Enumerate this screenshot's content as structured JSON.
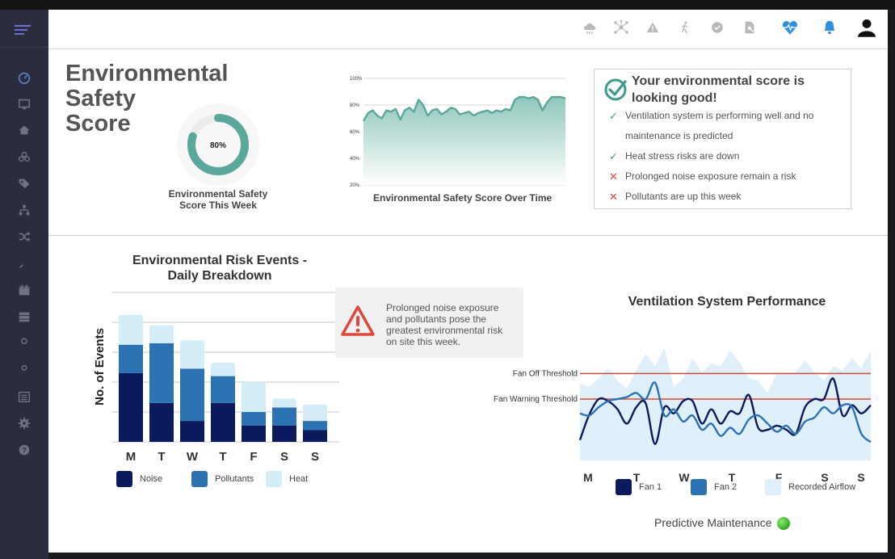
{
  "sidebar": {
    "icons": [
      "dashboard-icon",
      "monitor-icon",
      "home-icon",
      "biohazard-icon",
      "tags-icon",
      "org-chart-icon",
      "shuffle-icon",
      "rocket-icon",
      "calendar-icon",
      "server-icon",
      "user-icon",
      "user-shield-icon",
      "list-icon",
      "gear-icon",
      "help-icon"
    ]
  },
  "header": {
    "icons": [
      "cloud-icon",
      "network-icon",
      "warning-icon",
      "walking-person-icon",
      "check-circle-icon",
      "document-search-icon",
      "heart-monitor-icon",
      "bell-icon",
      "user-account-icon"
    ]
  },
  "score": {
    "title_lines": [
      "Environmental",
      "Safety",
      "Score"
    ],
    "gauge_value": 0.8,
    "gauge_text": "80%",
    "gauge_label": "Environmental Safety Score This Week"
  },
  "score_chart": {
    "caption": "Environmental Safety Score Over Time",
    "y_ticks": [
      "100%",
      "80%",
      "60%",
      "40%",
      "20%"
    ],
    "y_tick_values": [
      100,
      80,
      60,
      40,
      20
    ],
    "values": [
      68,
      74,
      76,
      72,
      70,
      76,
      75,
      77,
      69,
      76,
      78,
      75,
      84,
      80,
      72,
      76,
      77,
      73,
      75,
      78,
      77,
      73,
      74,
      75,
      72,
      74,
      75,
      76,
      74,
      76,
      75,
      77,
      76,
      84,
      86,
      86,
      85,
      86,
      84,
      76,
      82,
      86,
      86,
      86,
      85
    ]
  },
  "summary": {
    "title": "Your environmental score is looking good!",
    "items": [
      {
        "status": "good",
        "mark": "✓",
        "text_lines": [
          "Ventilation system is performing well and no",
          "maintenance is predicted"
        ]
      },
      {
        "status": "good",
        "mark": "✓",
        "text_lines": [
          "Heat stress risks are down"
        ]
      },
      {
        "status": "bad",
        "mark": "✕",
        "text_lines": [
          "Prolonged noise exposure remain a risk"
        ]
      },
      {
        "status": "bad",
        "mark": "✕",
        "text_lines": [
          "Pollutants are up this week"
        ]
      }
    ]
  },
  "risk_events": {
    "title_lines": [
      "Environmental Risk Events -",
      "Daily Breakdown"
    ],
    "ylabel": "No. of Events",
    "chart_data": {
      "type": "bar",
      "stacked": true,
      "categories": [
        "M",
        "T",
        "W",
        "T",
        "F",
        "S",
        "S"
      ],
      "series": [
        {
          "name": "Noise",
          "color": "#0b1a5c",
          "values": [
            46,
            26,
            14,
            26,
            11,
            11,
            8
          ]
        },
        {
          "name": "Pollutants",
          "color": "#2c73b4",
          "values": [
            19,
            40,
            35,
            18,
            9,
            12,
            6
          ]
        },
        {
          "name": "Heat",
          "color": "#d4edf7",
          "values": [
            20,
            12,
            19,
            9,
            20,
            6,
            11
          ]
        }
      ],
      "ylim": [
        0,
        100
      ],
      "grid": true,
      "legend": "bottom"
    }
  },
  "alert": {
    "icon": "warning-triangle-icon",
    "text_lines": [
      "Prolonged noise exposure",
      "and pollutants pose the",
      "greatest environmental risk",
      "on site this week."
    ]
  },
  "ventilation": {
    "title": "Ventilation System Performance",
    "thresholds": [
      {
        "label": "Fan Off Threshold",
        "value": 85
      },
      {
        "label": "Fan Warning Threshold",
        "value": 60
      }
    ],
    "chart_data": {
      "type": "line",
      "x": [
        "M",
        "T",
        "W",
        "T",
        "F",
        "S",
        "S"
      ],
      "ylim": [
        0,
        120
      ],
      "series": [
        {
          "name": "Recorded Airflow",
          "kind": "area",
          "color": "#dff0fa",
          "values": [
            75,
            72,
            80,
            90,
            78,
            70,
            88,
            104,
            92,
            110,
            72,
            80,
            100,
            86,
            95,
            92,
            108,
            96,
            80,
            78,
            66,
            86,
            84,
            86,
            98,
            86,
            78,
            92,
            88,
            100,
            90,
            108
          ]
        },
        {
          "name": "Fan 1",
          "kind": "line",
          "color": "#0b1a5c",
          "values": [
            20,
            45,
            60,
            58,
            50,
            36,
            52,
            56,
            16,
            52,
            46,
            58,
            58,
            36,
            50,
            36,
            48,
            46,
            64,
            32,
            30,
            34,
            30,
            26,
            52,
            60,
            60,
            80,
            44,
            54,
            46,
            54
          ]
        },
        {
          "name": "Fan 2",
          "kind": "line",
          "color": "#2c73b4",
          "values": [
            46,
            44,
            52,
            58,
            60,
            62,
            66,
            60,
            76,
            44,
            50,
            38,
            44,
            30,
            36,
            24,
            32,
            26,
            40,
            44,
            36,
            28,
            34,
            26,
            38,
            42,
            52,
            46,
            54,
            52,
            26,
            18
          ]
        }
      ],
      "legend": "bottom"
    }
  },
  "predictive": {
    "label": "Predictive Maintenance",
    "status_color": "#3fb22a"
  }
}
